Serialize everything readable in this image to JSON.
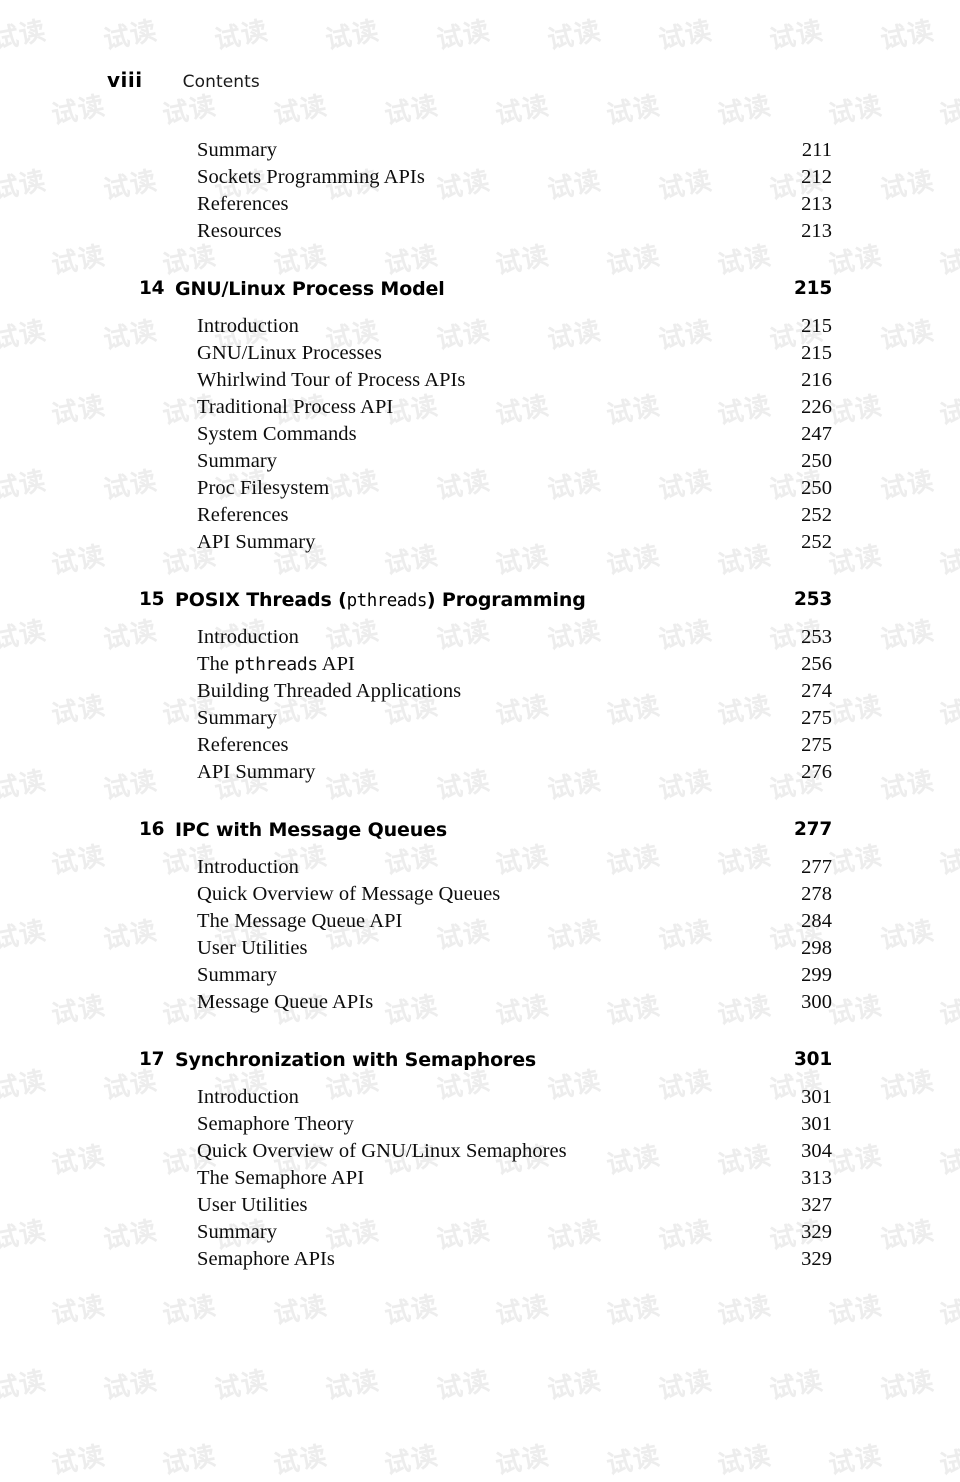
{
  "page": {
    "folio": "viii",
    "running_head": "Contents",
    "watermark_text": "试读",
    "watermark_color": "#ededed",
    "text_color": "#0d0d0d"
  },
  "toc": {
    "groups": [
      {
        "chapter": null,
        "entries": [
          {
            "title": "Summary",
            "page": "211"
          },
          {
            "title": "Sockets Programming APIs",
            "page": "212"
          },
          {
            "title": "References",
            "page": "213"
          },
          {
            "title": "Resources",
            "page": "213"
          }
        ]
      },
      {
        "chapter": {
          "number": "14",
          "title": "GNU/Linux Process Model",
          "title_parts": [
            {
              "text": "GNU/Linux Process Model",
              "mono": false
            }
          ],
          "page": "215"
        },
        "entries": [
          {
            "title": "Introduction",
            "page": "215"
          },
          {
            "title": "GNU/Linux Processes",
            "page": "215"
          },
          {
            "title": "Whirlwind Tour of Process APIs",
            "page": "216"
          },
          {
            "title": "Traditional Process API",
            "page": "226"
          },
          {
            "title": "System Commands",
            "page": "247"
          },
          {
            "title": "Summary",
            "page": "250"
          },
          {
            "title": "Proc Filesystem",
            "page": "250"
          },
          {
            "title": "References",
            "page": "252"
          },
          {
            "title": "API Summary",
            "page": "252"
          }
        ]
      },
      {
        "chapter": {
          "number": "15",
          "title": "POSIX Threads (pthreads) Programming",
          "title_parts": [
            {
              "text": "POSIX Threads (",
              "mono": false
            },
            {
              "text": "pthreads",
              "mono": true
            },
            {
              "text": ") Programming",
              "mono": false
            }
          ],
          "page": "253"
        },
        "entries": [
          {
            "title": "Introduction",
            "page": "253"
          },
          {
            "title": "The pthreads API",
            "title_parts": [
              {
                "text": "The ",
                "mono": false
              },
              {
                "text": "pthreads",
                "mono": true
              },
              {
                "text": " API",
                "mono": false
              }
            ],
            "page": "256"
          },
          {
            "title": "Building Threaded Applications",
            "page": "274"
          },
          {
            "title": "Summary",
            "page": "275"
          },
          {
            "title": "References",
            "page": "275"
          },
          {
            "title": "API Summary",
            "page": "276"
          }
        ]
      },
      {
        "chapter": {
          "number": "16",
          "title": "IPC with Message Queues",
          "title_parts": [
            {
              "text": "IPC with Message Queues",
              "mono": false
            }
          ],
          "page": "277"
        },
        "entries": [
          {
            "title": "Introduction",
            "page": "277"
          },
          {
            "title": "Quick Overview of Message Queues",
            "page": "278"
          },
          {
            "title": "The Message Queue API",
            "page": "284"
          },
          {
            "title": "User Utilities",
            "page": "298"
          },
          {
            "title": "Summary",
            "page": "299"
          },
          {
            "title": "Message Queue APIs",
            "page": "300"
          }
        ]
      },
      {
        "chapter": {
          "number": "17",
          "title": "Synchronization with Semaphores",
          "title_parts": [
            {
              "text": "Synchronization with Semaphores",
              "mono": false
            }
          ],
          "page": "301"
        },
        "entries": [
          {
            "title": "Introduction",
            "page": "301"
          },
          {
            "title": "Semaphore Theory",
            "page": "301"
          },
          {
            "title": "Quick Overview of GNU/Linux Semaphores",
            "page": "304"
          },
          {
            "title": "The Semaphore API",
            "page": "313"
          },
          {
            "title": "User Utilities",
            "page": "327"
          },
          {
            "title": "Summary",
            "page": "329"
          },
          {
            "title": "Semaphore APIs",
            "page": "329"
          }
        ]
      }
    ]
  }
}
